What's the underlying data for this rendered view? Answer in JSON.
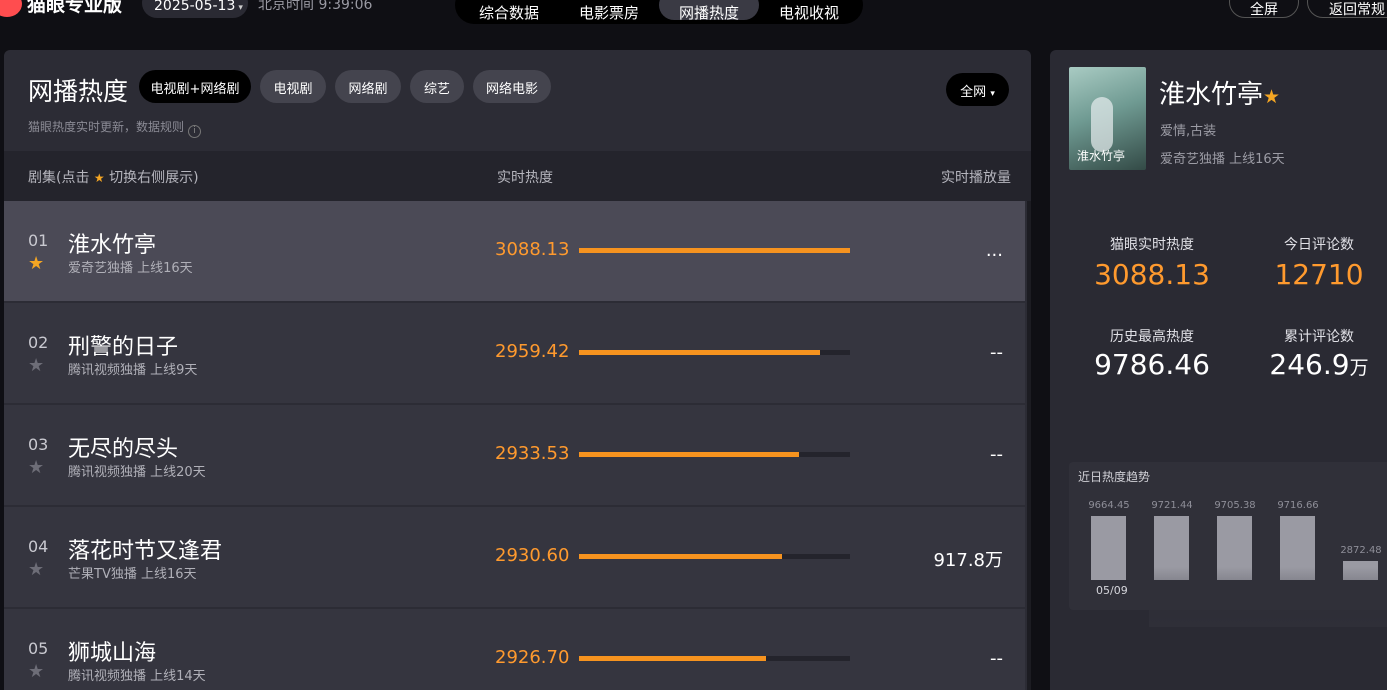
{
  "topbar": {
    "brand": "猫眼专业版",
    "date": "2025-05-13",
    "beijing_time": "北京时间 9:39:06",
    "nav": [
      "综合数据",
      "电影票房",
      "网播热度",
      "电视收视"
    ],
    "active_nav": "网播热度",
    "fullscreen": "全屏",
    "back": "返回常规"
  },
  "main": {
    "title": "网播热度",
    "filters": [
      "电视剧+网络剧",
      "电视剧",
      "网络剧",
      "综艺",
      "网络电影"
    ],
    "active_filter": "电视剧+网络剧",
    "scope": "全网",
    "subtitle": "猫眼热度实时更新，数据规则",
    "columns": {
      "series_prefix": "剧集(点击",
      "series_suffix": "切换右侧展示)",
      "heat": "实时热度",
      "plays": "实时播放量"
    },
    "rows": [
      {
        "rank": "01",
        "name": "淮水竹亭",
        "sub": "爱奇艺独播  上线16天",
        "heat": "3088.13",
        "heat_value": 3088.13,
        "plays": "...",
        "starred": true
      },
      {
        "rank": "02",
        "name": "刑警的日子",
        "sub": "腾讯视频独播  上线9天",
        "heat": "2959.42",
        "heat_value": 2959.42,
        "plays": "--",
        "starred": false
      },
      {
        "rank": "03",
        "name": "无尽的尽头",
        "sub": "腾讯视频独播  上线20天",
        "heat": "2933.53",
        "heat_value": 2933.53,
        "plays": "--",
        "starred": false
      },
      {
        "rank": "04",
        "name": "落花时节又逢君",
        "sub": "芒果TV独播  上线16天",
        "heat": "2930.60",
        "heat_value": 2930.6,
        "plays": "917.8万",
        "starred": false
      },
      {
        "rank": "05",
        "name": "狮城山海",
        "sub": "腾讯视频独播  上线14天",
        "heat": "2926.70",
        "heat_value": 2926.7,
        "plays": "--",
        "starred": false
      }
    ]
  },
  "side": {
    "poster_text": "淮水竹亭",
    "name": "淮水竹亭",
    "genre": "爱情,古装",
    "platform": "爱奇艺独播  上线16天",
    "stats": {
      "realtime_label": "猫眼实时热度",
      "realtime": "3088.13",
      "comments_today_label": "今日评论数",
      "comments_today": "12710",
      "history_label": "历史最高热度",
      "history": "9786.46",
      "total_comments_label": "累计评论数",
      "total_comments": "246.9",
      "total_comments_unit": "万"
    },
    "trend": {
      "title": "近日热度趋势",
      "date": "05/09",
      "bars": [
        {
          "label": "9664.45",
          "value": 9664.45
        },
        {
          "label": "9721.44",
          "value": 9721.44
        },
        {
          "label": "9705.38",
          "value": 9705.38
        },
        {
          "label": "9716.66",
          "value": 9716.66
        },
        {
          "label": "2872.48",
          "value": 2872.48
        }
      ]
    }
  },
  "colors": {
    "accent": "#ff9a2e",
    "bar": "#f6931f",
    "star": "#f5a623"
  }
}
